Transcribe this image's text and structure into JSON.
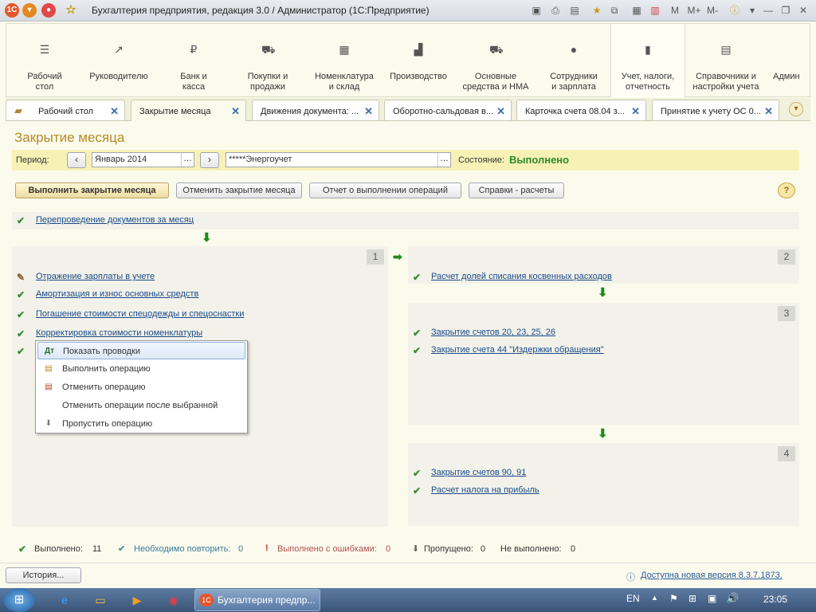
{
  "window": {
    "title": "Бухгалтерия предприятия, редакция 3.0 / Администратор  (1С:Предприятие)",
    "right_icons": [
      "M",
      "M+",
      "M-"
    ]
  },
  "sections": [
    {
      "label": "Рабочий\nстол",
      "icon": "menu-icon"
    },
    {
      "label": "Руководителю",
      "icon": "trend-icon"
    },
    {
      "label": "Банк и\nкасса",
      "icon": "ruble-icon"
    },
    {
      "label": "Покупки и\nпродажи",
      "icon": "cart-icon"
    },
    {
      "label": "Номенклатура\nи склад",
      "icon": "grid-icon"
    },
    {
      "label": "Производство",
      "icon": "factory-icon"
    },
    {
      "label": "Основные\nсредства и НМА",
      "icon": "truck-icon"
    },
    {
      "label": "Сотрудники\nи зарплата",
      "icon": "person-icon"
    },
    {
      "label": "Учет, налоги,\nотчетность",
      "icon": "bar-chart-icon"
    },
    {
      "label": "Справочники и\nнастройки учета",
      "icon": "book-icon"
    },
    {
      "label": "Админ",
      "icon": "admin-icon"
    }
  ],
  "tabs": [
    {
      "label": "Рабочий стол"
    },
    {
      "label": "Закрытие месяца"
    },
    {
      "label": "Движения документа: ..."
    },
    {
      "label": "Оборотно-сальдовая в..."
    },
    {
      "label": "Карточка счета 08.04 з..."
    },
    {
      "label": "Принятие к учету ОС 0..."
    }
  ],
  "page": {
    "title": "Закрытие месяца",
    "period_label": "Период:",
    "period_value": "Январь 2014",
    "org_value": "*****Энергоучет",
    "state_label": "Состояние:",
    "state_value": "Выполнено"
  },
  "buttons": {
    "execute": "Выполнить закрытие месяца",
    "cancel": "Отменить закрытие месяца",
    "report": "Отчет о выполнении операций",
    "info": "Справки - расчеты",
    "help": "?"
  },
  "steps": {
    "repost": "Перепроведение документов за месяц",
    "group1": [
      "Отражение зарплаты в учете",
      "Амортизация и износ основных средств",
      "Погашение стоимости спецодежды и спецоснастки",
      "Корректировка стоимости номенклатуры"
    ],
    "group2": [
      "Расчет долей списания косвенных расходов"
    ],
    "group3": [
      "Закрытие счетов 20, 23, 25, 26",
      "Закрытие счета 44 \"Издержки обращения\""
    ],
    "group4": [
      "Закрытие счетов 90, 91",
      "Расчет налога на прибыль"
    ],
    "numbers": [
      "1",
      "2",
      "3",
      "4"
    ]
  },
  "context_menu": [
    "Показать проводки",
    "Выполнить операцию",
    "Отменить операцию",
    "Отменить операции после выбранной",
    "Пропустить операцию"
  ],
  "status": {
    "done_label": "Выполнено:",
    "done_value": "11",
    "repeat_label": "Необходимо повторить:",
    "repeat_value": "0",
    "errors_label": "Выполнено с ошибками:",
    "errors_value": "0",
    "skipped_label": "Пропущено:",
    "skipped_value": "0",
    "notdone_label": "Не выполнено:",
    "notdone_value": "0"
  },
  "bottom": {
    "history": "История...",
    "update": "Доступна новая версия 8.3.7.1873."
  },
  "taskbar": {
    "app": "Бухгалтерия предпр...",
    "lang": "EN",
    "time": "23:05"
  },
  "colors": {
    "accent_title": "#b58a24",
    "state_ok": "#2a8a2a",
    "link": "#1a4a8a",
    "check": "#3a8a3a"
  }
}
